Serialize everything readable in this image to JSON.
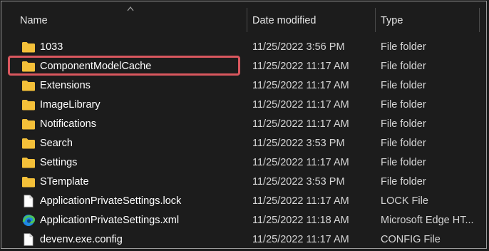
{
  "header": {
    "name_label": "Name",
    "date_label": "Date modified",
    "type_label": "Type",
    "sort": "ascending"
  },
  "files": [
    {
      "icon": "folder-icon",
      "name": "1033",
      "date": "11/25/2022 3:56 PM",
      "type": "File folder"
    },
    {
      "icon": "folder-icon",
      "name": "ComponentModelCache",
      "date": "11/25/2022 11:17 AM",
      "type": "File folder",
      "highlighted": true
    },
    {
      "icon": "folder-icon",
      "name": "Extensions",
      "date": "11/25/2022 11:17 AM",
      "type": "File folder"
    },
    {
      "icon": "folder-icon",
      "name": "ImageLibrary",
      "date": "11/25/2022 11:17 AM",
      "type": "File folder"
    },
    {
      "icon": "folder-icon",
      "name": "Notifications",
      "date": "11/25/2022 11:17 AM",
      "type": "File folder"
    },
    {
      "icon": "folder-icon",
      "name": "Search",
      "date": "11/25/2022 3:53 PM",
      "type": "File folder"
    },
    {
      "icon": "folder-icon",
      "name": "Settings",
      "date": "11/25/2022 11:17 AM",
      "type": "File folder"
    },
    {
      "icon": "folder-icon",
      "name": "STemplate",
      "date": "11/25/2022 3:53 PM",
      "type": "File folder"
    },
    {
      "icon": "file-icon",
      "name": "ApplicationPrivateSettings.lock",
      "date": "11/25/2022 11:17 AM",
      "type": "LOCK File"
    },
    {
      "icon": "edge-icon",
      "name": "ApplicationPrivateSettings.xml",
      "date": "11/25/2022 11:18 AM",
      "type": "Microsoft Edge HT..."
    },
    {
      "icon": "file-icon",
      "name": "devenv.exe.config",
      "date": "11/25/2022 11:17 AM",
      "type": "CONFIG File"
    }
  ],
  "colors": {
    "background": "#1c1c1c",
    "folder": "#f3c03a",
    "highlight": "#d9575e",
    "edge_blue": "#1e88e5",
    "edge_green": "#4cc35a"
  }
}
